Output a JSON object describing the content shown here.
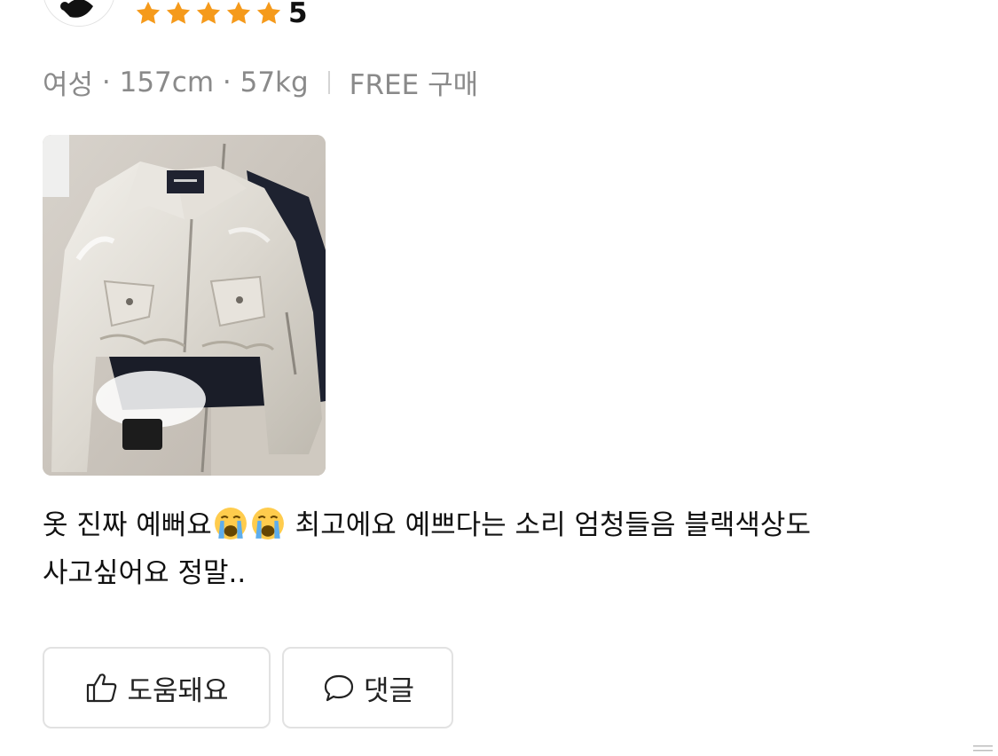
{
  "review": {
    "rating": "5",
    "star_color": "#f59a1b",
    "meta": {
      "gender": "여성",
      "height": "157cm",
      "weight": "57kg",
      "purchase": "FREE 구매"
    },
    "text_line1_a": "옷 진짜 예뻐요",
    "text_line1_b": " 최고에요 예쁘다는 소리 엄청들음 블랙색상도",
    "text_line2": "사고싶어요 정말..",
    "emoji": "loudly-crying-face"
  },
  "actions": {
    "helpful_label": "도움돼요",
    "comment_label": "댓글",
    "helpful_icon": "thumbs-up-icon",
    "comment_icon": "speech-bubble-icon"
  }
}
